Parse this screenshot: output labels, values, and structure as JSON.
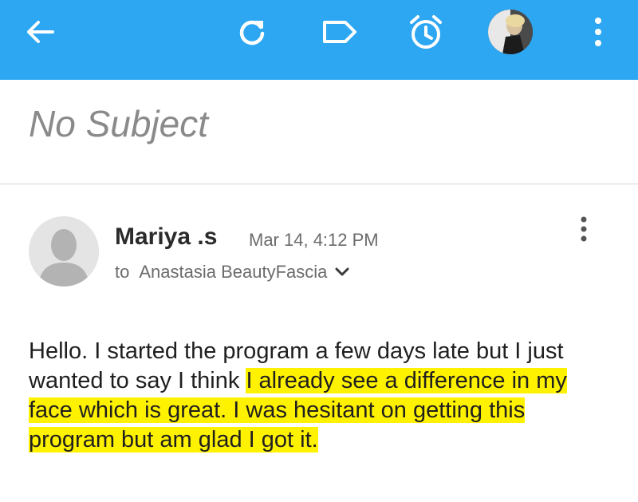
{
  "appbar": {
    "color": "#2ea7f2",
    "icons": [
      "back-arrow-icon",
      "refresh-icon",
      "label-icon",
      "alarm-icon",
      "account-avatar",
      "more-vert-icon"
    ]
  },
  "email": {
    "subject": "No Subject",
    "sender_name": "Mariya .s",
    "date": "Mar 14, 4:12 PM",
    "to_prefix": "to",
    "recipient": "Anastasia BeautyFascia",
    "body_plain": "Hello. I started the program a few days late but I just wanted to say I think ",
    "body_highlighted": "I already see a difference in my face which is great. I was hesitant on getting this program but am glad I got it.",
    "highlight_color": "#fff200"
  }
}
